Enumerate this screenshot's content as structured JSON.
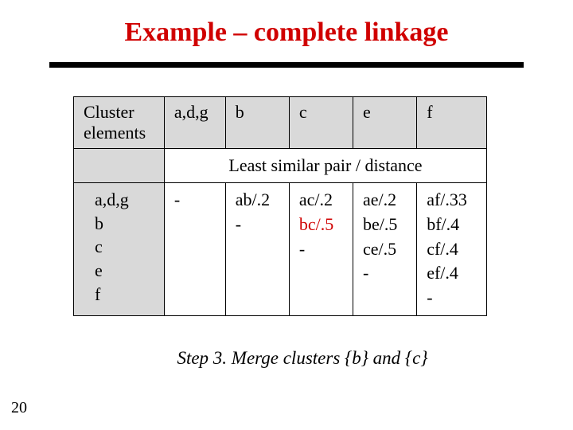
{
  "title": "Example – complete linkage",
  "table": {
    "headers": [
      "Cluster elements",
      "a,d,g",
      "b",
      "c",
      "e",
      "f"
    ],
    "subhead": "Least similar pair / distance",
    "row_labels": [
      "a,d,g",
      "b",
      "c",
      "e",
      "f"
    ],
    "cols": {
      "c0": [
        "-",
        "",
        "",
        "",
        ""
      ],
      "c1": [
        "ab/.2",
        "-",
        "",
        "",
        ""
      ],
      "c2": [
        "ac/.2",
        "bc/.5",
        "-",
        "",
        ""
      ],
      "c3": [
        "ae/.2",
        "be/.5",
        "ce/.5",
        "-",
        ""
      ],
      "c4": [
        "af/.33",
        "bf/.4",
        "cf/.4",
        "ef/.4",
        "-"
      ]
    },
    "highlight": {
      "col": "c2",
      "line": 1
    }
  },
  "caption": "Step 3.  Merge clusters {b} and {c}",
  "page_number": "20"
}
